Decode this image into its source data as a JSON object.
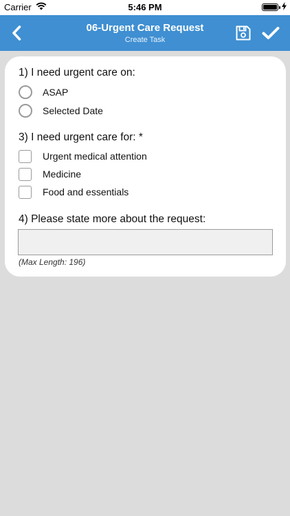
{
  "status_bar": {
    "carrier": "Carrier",
    "time": "5:46 PM"
  },
  "nav": {
    "title": "06-Urgent Care Request",
    "subtitle": "Create Task",
    "icons": [
      "back-chevron-icon",
      "save-floppy-icon",
      "checkmark-icon"
    ],
    "color": "#3f8fd2"
  },
  "form": {
    "q1": {
      "label": "1) I need urgent care on:",
      "options": [
        "ASAP",
        "Selected Date"
      ]
    },
    "q3": {
      "label": "3) I need urgent care for: *",
      "options": [
        "Urgent medical attention",
        "Medicine",
        "Food and essentials"
      ]
    },
    "q4": {
      "label": "4) Please state more about the request:",
      "value": "",
      "hint": "(Max Length: 196)"
    }
  }
}
